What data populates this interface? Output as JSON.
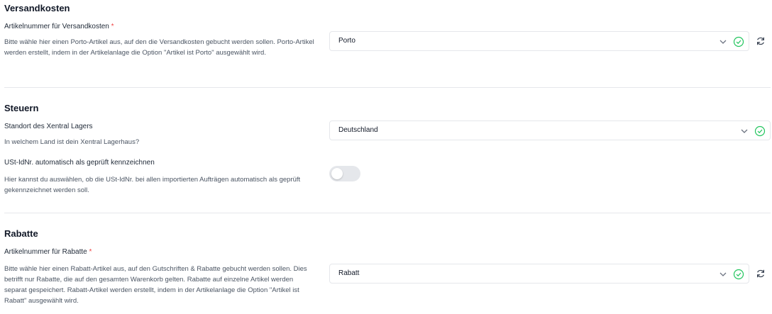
{
  "versand": {
    "title": "Versandkosten",
    "label": "Artikelnummer für Versandkosten",
    "required": "*",
    "description": "Bitte wähle hier einen Porto-Artikel aus, auf den die Versandkosten gebucht werden sollen. Porto-Artikel werden erstellt, indem in der Artikelanlage die Option \"Artikel ist Porto\" ausgewählt wird.",
    "select_value": "Porto"
  },
  "steuern": {
    "title": "Steuern",
    "standort_label": "Standort des Xentral Lagers",
    "standort_desc": "In welchem Land ist dein Xentral Lagerhaus?",
    "standort_value": "Deutschland",
    "ust_label": "USt-IdNr. automatisch als geprüft kennzeichnen",
    "ust_desc": "Hier kannst du auswählen, ob die USt-IdNr. bei allen importierten Aufträgen automatisch als geprüft gekennzeichnet werden soll.",
    "ust_toggle_on": false
  },
  "rabatte": {
    "title": "Rabatte",
    "label": "Artikelnummer für Rabatte",
    "required": "*",
    "description": "Bitte wähle hier einen Rabatt-Artikel aus, auf den Gutschriften & Rabatte gebucht werden sollen. Dies betrifft nur Rabatte, die auf den gesamten Warenkorb gelten. Rabatte auf einzelne Artikel werden separat gespeichert. Rabatt-Artikel werden erstellt, indem in der Artikelanlage die Option \"Artikel ist Rabatt\" ausgewählt wird.",
    "select_value": "Rabatt"
  },
  "colors": {
    "accent_check": "#22c55e",
    "required": "#ef4444"
  },
  "icons": [
    "chevron-down-icon",
    "check-circle-icon",
    "refresh-icon"
  ]
}
